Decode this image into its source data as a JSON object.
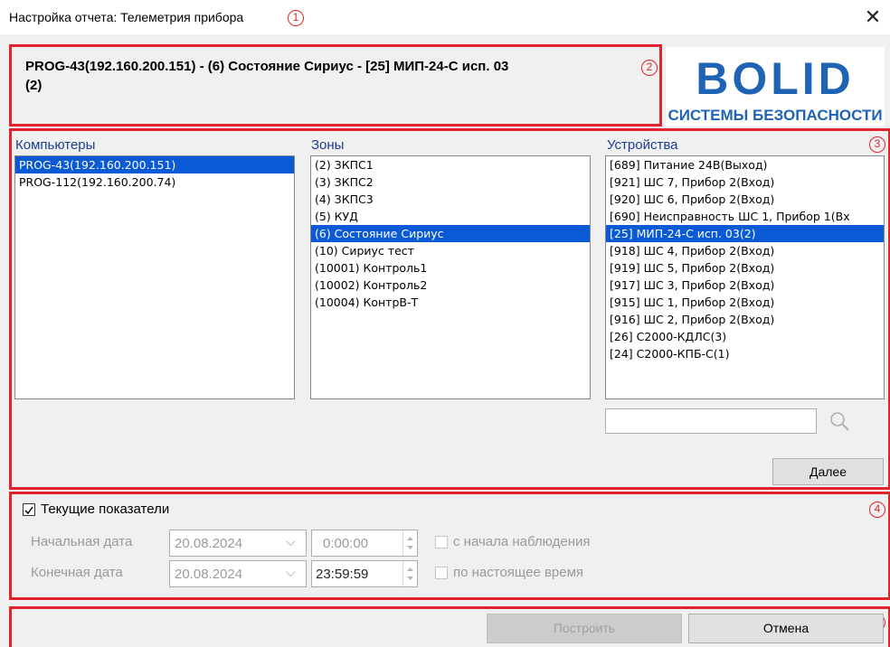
{
  "window": {
    "title": "Настройка отчета: Телеметрия прибора",
    "close_glyph": "✕"
  },
  "header": {
    "line1": "PROG-43(192.160.200.151) - (6) Состояние Сириус - [25] МИП-24-С исп. 03",
    "line2": "(2)"
  },
  "logo": {
    "top": "BOLID",
    "bottom": "СИСТЕМЫ БЕЗОПАСНОСТИ",
    "color": "#1f63b5"
  },
  "badges": [
    "1",
    "2",
    "3",
    "4",
    "5"
  ],
  "computers": {
    "label": "Компьютеры",
    "items": [
      {
        "text": "PROG-43(192.160.200.151)",
        "selected": true
      },
      {
        "text": "PROG-112(192.160.200.74)",
        "selected": false
      }
    ]
  },
  "zones": {
    "label": "Зоны",
    "items": [
      {
        "text": "(2) ЗКПС1",
        "selected": false
      },
      {
        "text": "(3) ЗКПС2",
        "selected": false
      },
      {
        "text": "(4) ЗКПС3",
        "selected": false
      },
      {
        "text": "(5) КУД",
        "selected": false
      },
      {
        "text": "(6) Состояние Сириус",
        "selected": true
      },
      {
        "text": "(10) Сириус тест",
        "selected": false
      },
      {
        "text": "(10001) Контроль1",
        "selected": false
      },
      {
        "text": "(10002) Контроль2",
        "selected": false
      },
      {
        "text": "(10004) КонтрВ-Т",
        "selected": false
      }
    ]
  },
  "devices": {
    "label": "Устройства",
    "items": [
      {
        "text": "[689] Питание 24В(Выход)",
        "selected": false
      },
      {
        "text": "[921] ШС 7, Прибор 2(Вход)",
        "selected": false
      },
      {
        "text": "[920] ШС 6, Прибор 2(Вход)",
        "selected": false
      },
      {
        "text": "[690] Неисправность ШС 1, Прибор 1(Вх",
        "selected": false
      },
      {
        "text": "[25] МИП-24-С исп. 03(2)",
        "selected": true
      },
      {
        "text": "[918] ШС 4, Прибор 2(Вход)",
        "selected": false
      },
      {
        "text": "[919] ШС 5, Прибор 2(Вход)",
        "selected": false
      },
      {
        "text": "[917] ШС 3, Прибор 2(Вход)",
        "selected": false
      },
      {
        "text": "[915] ШС 1, Прибор 2(Вход)",
        "selected": false
      },
      {
        "text": "[916] ШС 2, Прибор 2(Вход)",
        "selected": false
      },
      {
        "text": "[26] С2000-КДЛС(3)",
        "selected": false
      },
      {
        "text": "[24] С2000-КПБ-С(1)",
        "selected": false
      }
    ],
    "search_value": "",
    "search_icon": "magnifier-icon"
  },
  "next_button": "Далее",
  "period": {
    "current_values_label": "Текущие показатели",
    "current_values_checked": true,
    "start_label": "Начальная дата",
    "start_date": "20.08.2024",
    "start_time": "0:00:00",
    "from_start_label": "с начала наблюдения",
    "end_label": "Конечная дата",
    "end_date": "20.08.2024",
    "end_time": "23:59:59",
    "until_now_label": "по настоящее время"
  },
  "footer": {
    "build_button": "Построить",
    "cancel_button": "Отмена"
  },
  "colors": {
    "annotation_red": "#e0232c",
    "selection_blue": "#0a5ad6"
  }
}
